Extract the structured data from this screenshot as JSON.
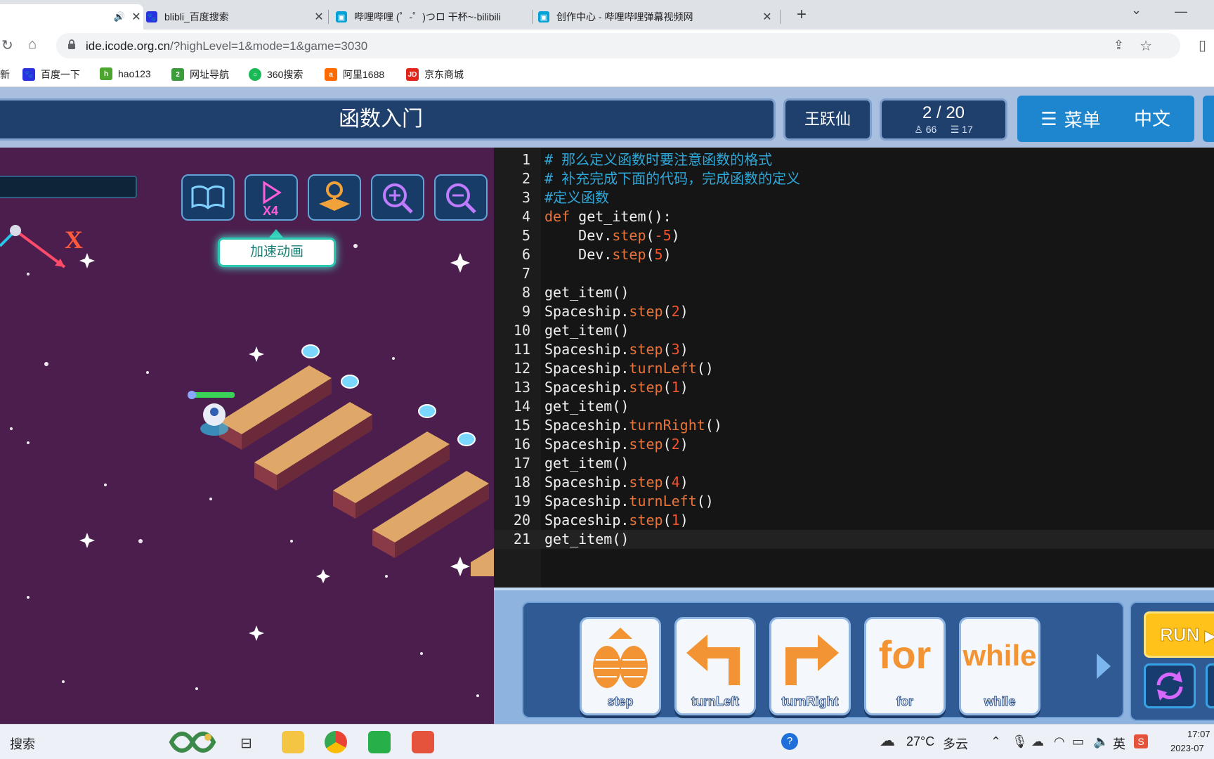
{
  "browser": {
    "tabs": [
      {
        "title": "",
        "active": true
      },
      {
        "title": "blibli_百度搜索"
      },
      {
        "title": "哔哩哔哩 (゜-゜)つロ 干杯~-bilibili"
      },
      {
        "title": "创作中心 - 哔哩哔哩弹幕视频网"
      }
    ],
    "url_host": "ide.icode.org.cn",
    "url_rest": "/?highLevel=1&mode=1&game=3030",
    "bookmarks": [
      {
        "label": "新",
        "color": "#ffffff"
      },
      {
        "label": "百度一下",
        "color": "#2932e1"
      },
      {
        "label": "hao123",
        "color": "#4ca52e"
      },
      {
        "label": "网址导航",
        "color": "#3a9c3a"
      },
      {
        "label": "360搜索",
        "color": "#19b955"
      },
      {
        "label": "阿里1688",
        "color": "#ff6a00"
      },
      {
        "label": "京东商城",
        "color": "#e1251b"
      }
    ]
  },
  "game": {
    "title": "函数入门",
    "user": "王跃仙",
    "progress": "2 / 20",
    "stat_a": "66",
    "stat_b": "17",
    "menu_label": "菜单",
    "lang_label": "中文",
    "tooltip": "加速动画",
    "axis_label": "X"
  },
  "code_lines": [
    [
      [
        "c-com",
        "# 那么定义函数时要注意函数的格式"
      ]
    ],
    [
      [
        "c-com",
        "# 补充完成下面的代码，完成函数的定义"
      ]
    ],
    [
      [
        "c-com",
        "#定义函数"
      ]
    ],
    [
      [
        "c-kw",
        "def "
      ],
      [
        "c-fn",
        "get_item():"
      ]
    ],
    [
      [
        "c-fn",
        "    Dev."
      ],
      [
        "c-kw",
        "step"
      ],
      [
        "c-fn",
        "("
      ],
      [
        "c-num",
        "-5"
      ],
      [
        "c-fn",
        ")"
      ]
    ],
    [
      [
        "c-fn",
        "    Dev."
      ],
      [
        "c-kw",
        "step"
      ],
      [
        "c-fn",
        "("
      ],
      [
        "c-num",
        "5"
      ],
      [
        "c-fn",
        ")"
      ]
    ],
    [
      [
        "c-fn",
        ""
      ]
    ],
    [
      [
        "c-fn",
        "get_item()"
      ]
    ],
    [
      [
        "c-fn",
        "Spaceship."
      ],
      [
        "c-kw",
        "step"
      ],
      [
        "c-fn",
        "("
      ],
      [
        "c-num",
        "2"
      ],
      [
        "c-fn",
        ")"
      ]
    ],
    [
      [
        "c-fn",
        "get_item()"
      ]
    ],
    [
      [
        "c-fn",
        "Spaceship."
      ],
      [
        "c-kw",
        "step"
      ],
      [
        "c-fn",
        "("
      ],
      [
        "c-num",
        "3"
      ],
      [
        "c-fn",
        ")"
      ]
    ],
    [
      [
        "c-fn",
        "Spaceship."
      ],
      [
        "c-kw",
        "turnLeft"
      ],
      [
        "c-fn",
        "()"
      ]
    ],
    [
      [
        "c-fn",
        "Spaceship."
      ],
      [
        "c-kw",
        "step"
      ],
      [
        "c-fn",
        "("
      ],
      [
        "c-num",
        "1"
      ],
      [
        "c-fn",
        ")"
      ]
    ],
    [
      [
        "c-fn",
        "get_item()"
      ]
    ],
    [
      [
        "c-fn",
        "Spaceship."
      ],
      [
        "c-kw",
        "turnRight"
      ],
      [
        "c-fn",
        "()"
      ]
    ],
    [
      [
        "c-fn",
        "Spaceship."
      ],
      [
        "c-kw",
        "step"
      ],
      [
        "c-fn",
        "("
      ],
      [
        "c-num",
        "2"
      ],
      [
        "c-fn",
        ")"
      ]
    ],
    [
      [
        "c-fn",
        "get_item()"
      ]
    ],
    [
      [
        "c-fn",
        "Spaceship."
      ],
      [
        "c-kw",
        "step"
      ],
      [
        "c-fn",
        "("
      ],
      [
        "c-num",
        "4"
      ],
      [
        "c-fn",
        ")"
      ]
    ],
    [
      [
        "c-fn",
        "Spaceship."
      ],
      [
        "c-kw",
        "turnLeft"
      ],
      [
        "c-fn",
        "()"
      ]
    ],
    [
      [
        "c-fn",
        "Spaceship."
      ],
      [
        "c-kw",
        "step"
      ],
      [
        "c-fn",
        "("
      ],
      [
        "c-num",
        "1"
      ],
      [
        "c-fn",
        ")"
      ]
    ],
    [
      [
        "c-fn",
        "get_item()"
      ]
    ]
  ],
  "commands": [
    {
      "label": "step",
      "glyph": ""
    },
    {
      "label": "turnLeft",
      "glyph": ""
    },
    {
      "label": "turnRight",
      "glyph": ""
    },
    {
      "label": "for",
      "glyph": "for"
    },
    {
      "label": "while",
      "glyph": "while"
    }
  ],
  "run_label": "RUN",
  "taskbar": {
    "search": "搜索",
    "weather_temp": "27°C",
    "weather_desc": "多云",
    "ime": "英",
    "time": "17:07",
    "date": "2023-07"
  },
  "colors": {
    "header_bg": "#1f3f6d",
    "scene_bg": "#4b1e4d",
    "editor_bg": "#151515",
    "comment": "#2ea7d8",
    "keyword": "#e8743b",
    "number": "#f5532d"
  }
}
